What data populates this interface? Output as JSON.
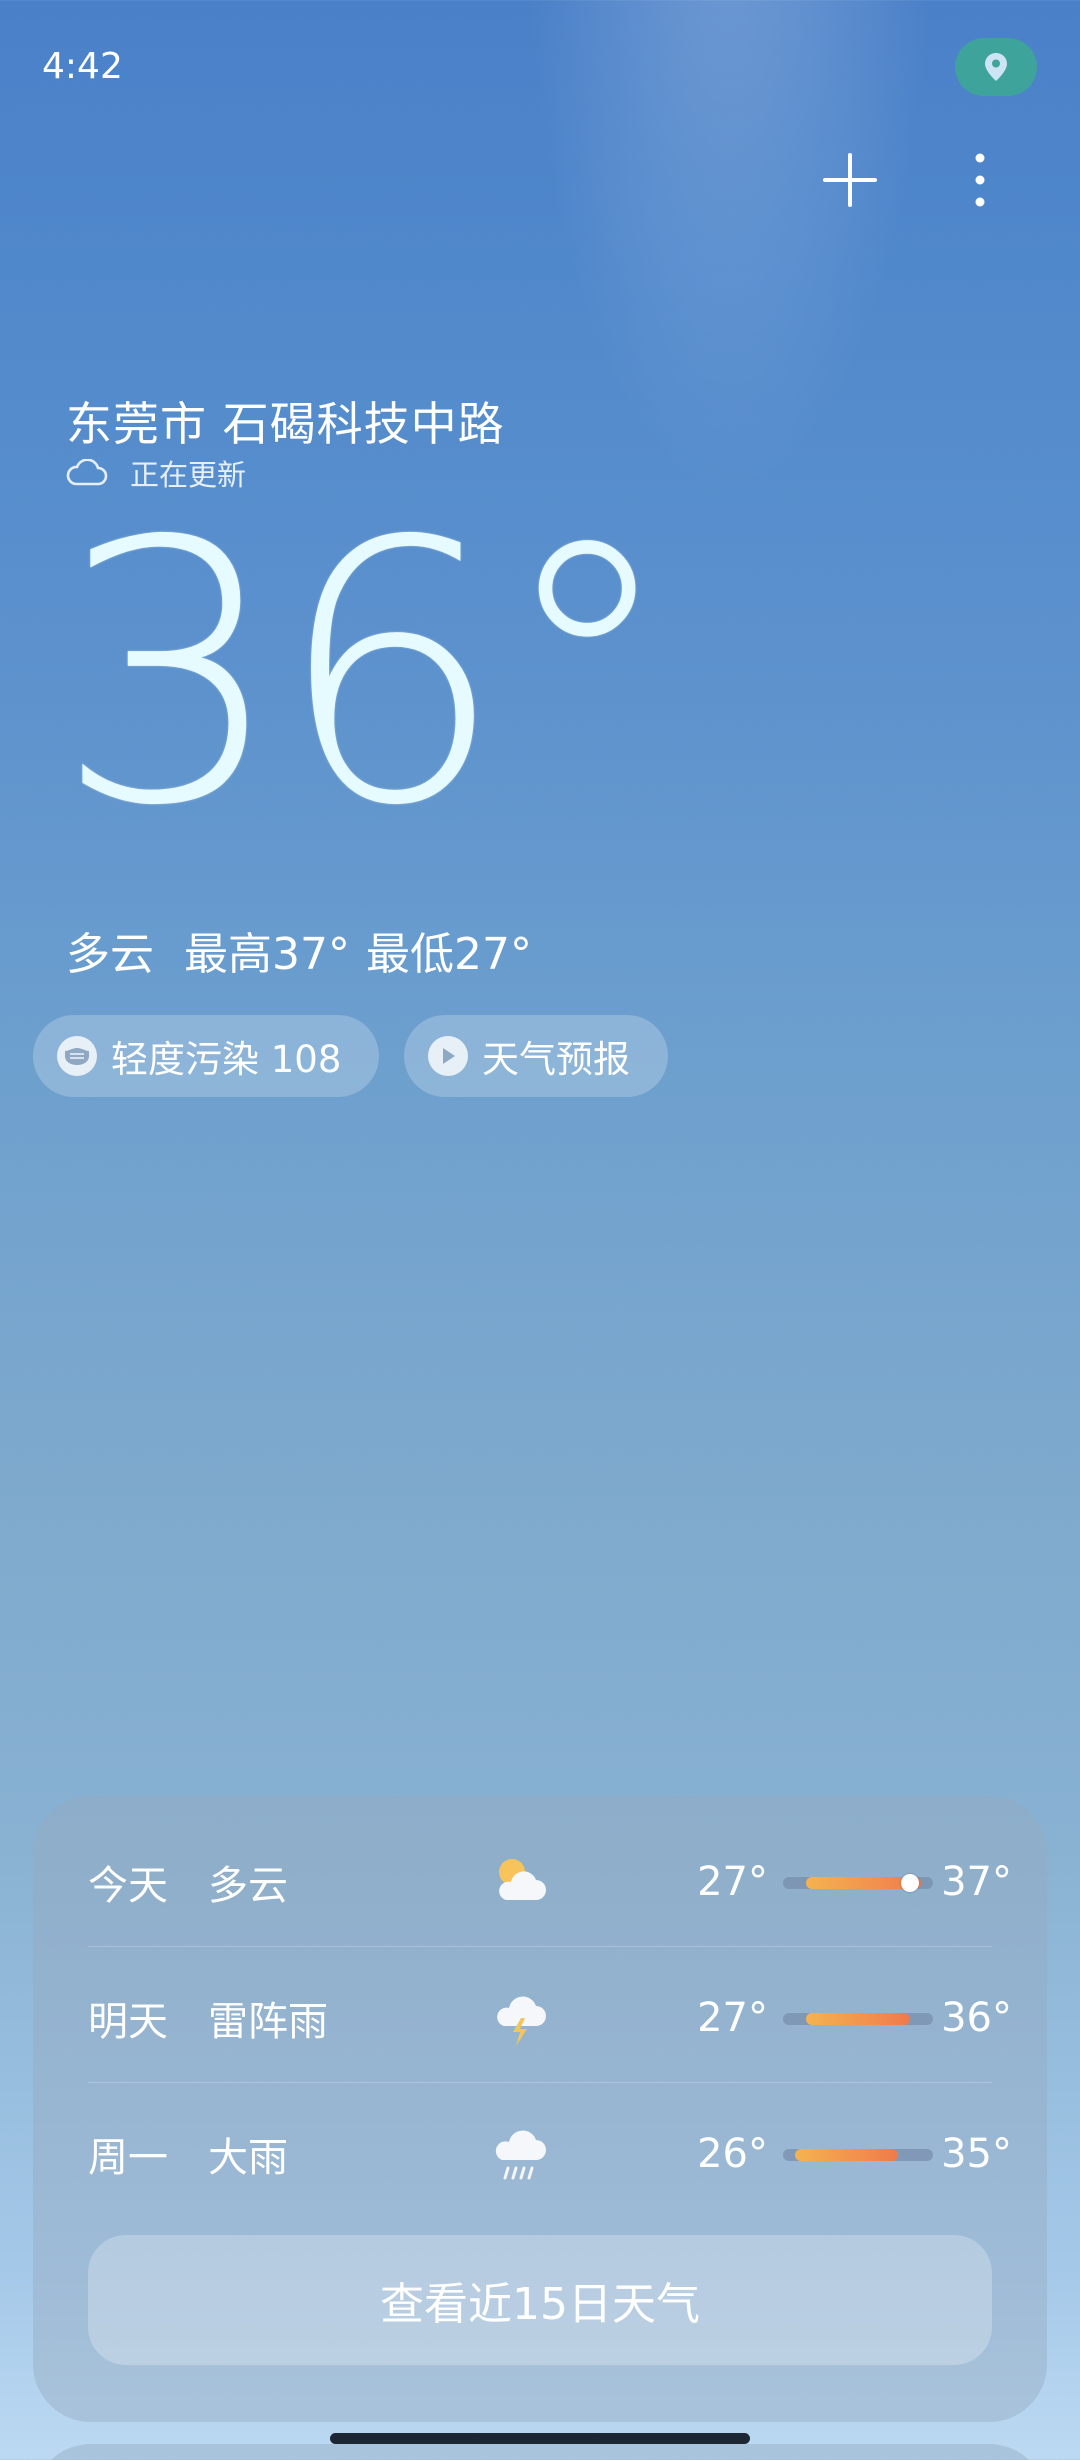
{
  "status_bar": {
    "time": "4:42",
    "location_icon": "location-pin-icon"
  },
  "toolbar": {
    "add_icon": "plus-icon",
    "more_icon": "more-vertical-icon"
  },
  "location": {
    "name": "东莞市 石碣科技中路",
    "update_status": "正在更新",
    "update_icon": "cloud-icon"
  },
  "current": {
    "temperature": "36°",
    "condition": "多云",
    "high": "最高37°",
    "low": "最低27°"
  },
  "chips": {
    "aqi_label": "轻度污染 108",
    "aqi_icon": "mask-icon",
    "forecast_label": "天气预报",
    "forecast_icon": "play-icon"
  },
  "daily": [
    {
      "day": "今天",
      "condition": "多云",
      "icon": "partly-cloudy-icon",
      "low": "27°",
      "high": "37°",
      "current_marker": true
    },
    {
      "day": "明天",
      "condition": "雷阵雨",
      "icon": "thunderstorm-icon",
      "low": "27°",
      "high": "36°",
      "current_marker": false
    },
    {
      "day": "周一",
      "condition": "大雨",
      "icon": "heavy-rain-icon",
      "low": "26°",
      "high": "35°",
      "current_marker": false
    }
  ],
  "range_scale": {
    "min": 25,
    "max": 38
  },
  "cta_label": "查看近15日天气",
  "colors": {
    "status_location_bg": "#3ea39a",
    "temp_bar_start": "#f4b350",
    "temp_bar_end": "#f07a4c"
  }
}
